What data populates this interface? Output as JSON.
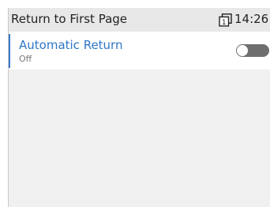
{
  "header": {
    "title": "Return to First Page",
    "time": "14:26",
    "sim_label": "1"
  },
  "setting": {
    "title": "Automatic Return",
    "value": "Off",
    "enabled": false
  },
  "colors": {
    "accent": "#2f76c6",
    "header_bg": "#e8e8e8",
    "body_bg": "#f0f0f0",
    "toggle_off": "#6e6e6e"
  }
}
